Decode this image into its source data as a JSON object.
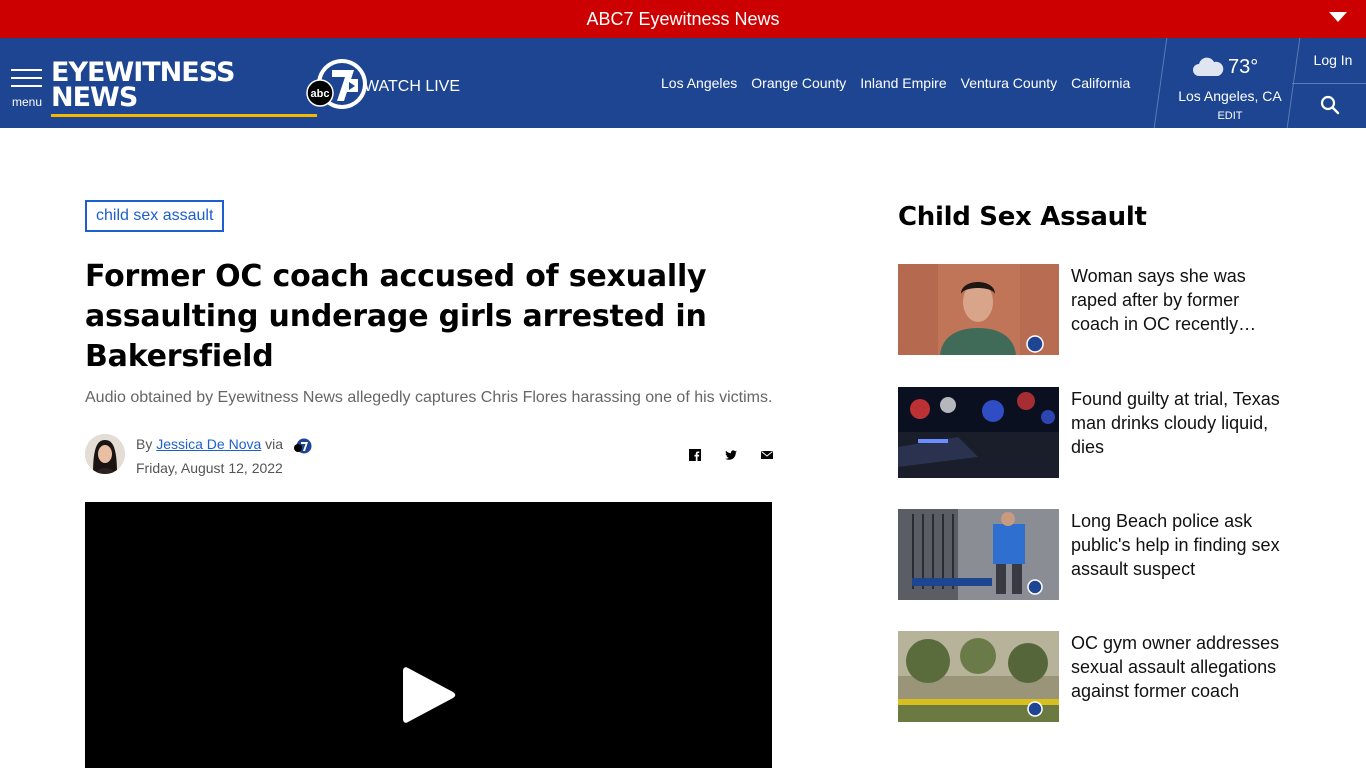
{
  "topbar": {
    "title": "ABC7 Eyewitness News"
  },
  "nav": {
    "menu_label": "menu",
    "logo_line1": "EYEWITNESS",
    "logo_line2": "NEWS",
    "watch_live": "WATCH LIVE",
    "links": [
      "Los Angeles",
      "Orange County",
      "Inland Empire",
      "Ventura County",
      "California"
    ],
    "weather": {
      "temp": "73°",
      "location": "Los Angeles, CA",
      "edit": "EDIT"
    },
    "login": "Log In"
  },
  "article": {
    "tag": "child sex assault",
    "headline": "Former OC coach accused of sexually assaulting underage girls arrested in Bakersfield",
    "dek": "Audio obtained by Eyewitness News allegedly captures Chris Flores harassing one of his victims.",
    "byline_prefix": "By",
    "author": "Jessica De Nova",
    "via": "via",
    "date": "Friday, August 12, 2022"
  },
  "sidebar": {
    "title": "Child Sex Assault",
    "stories": [
      {
        "title": "Woman says she was raped after by former coach in OC recently…"
      },
      {
        "title": "Found guilty at trial, Texas man drinks cloudy liquid, dies"
      },
      {
        "title": "Long Beach police ask public's help in finding sex assault suspect"
      },
      {
        "title": "OC gym owner addresses sexual assault allegations against former coach"
      }
    ]
  },
  "colors": {
    "brand_red": "#cc0000",
    "nav_blue": "#1d4591",
    "link_blue": "#1d5fce",
    "logo_gold": "#f5b800"
  }
}
